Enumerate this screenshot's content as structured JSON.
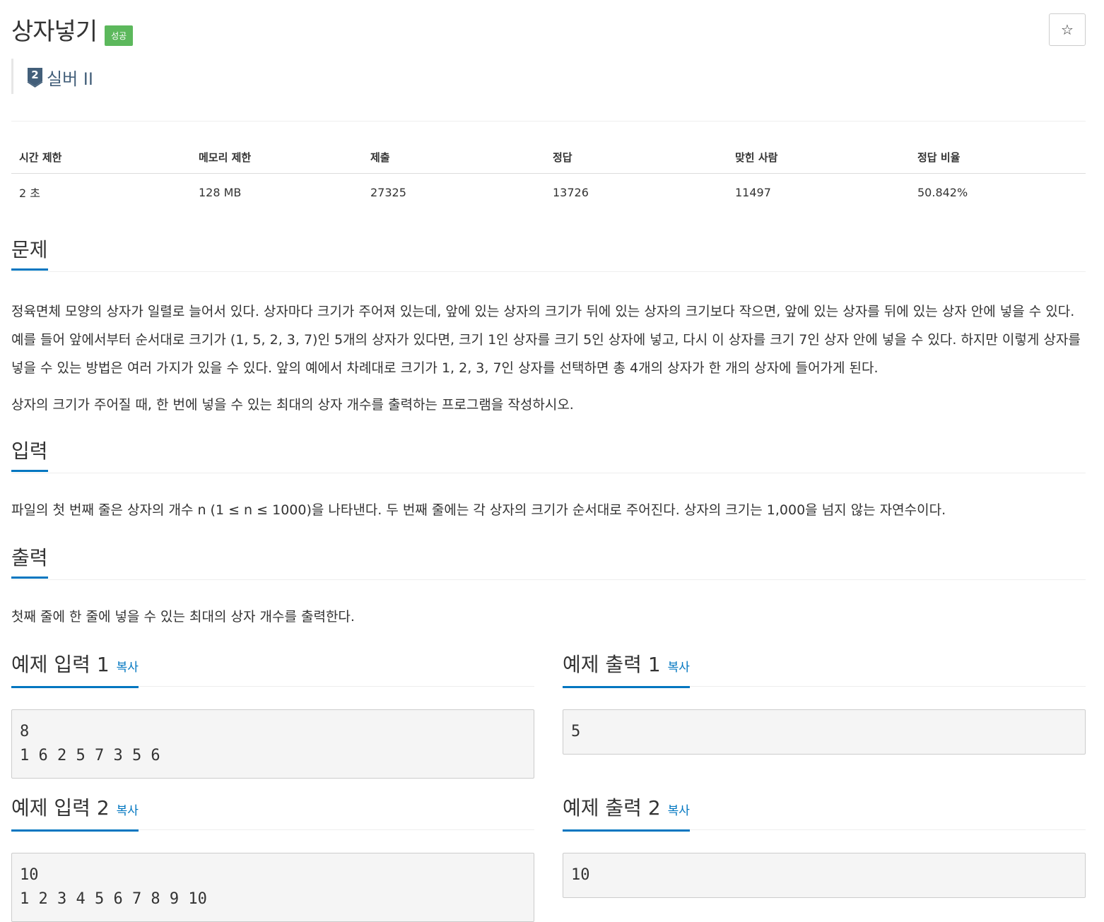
{
  "header": {
    "title": "상자넣기",
    "result_badge": "성공",
    "tier_label": "실버 II",
    "tier_number": "2",
    "star_icon_glyph": "☆"
  },
  "stats": {
    "headers": [
      "시간 제한",
      "메모리 제한",
      "제출",
      "정답",
      "맞힌 사람",
      "정답 비율"
    ],
    "values": [
      "2 초",
      "128 MB",
      "27325",
      "13726",
      "11497",
      "50.842%"
    ]
  },
  "problem": {
    "title": "문제",
    "paragraphs": [
      "정육면체 모양의 상자가 일렬로 늘어서 있다. 상자마다 크기가 주어져 있는데, 앞에 있는 상자의 크기가 뒤에 있는 상자의 크기보다 작으면, 앞에 있는 상자를 뒤에 있는 상자 안에 넣을 수 있다. 예를 들어 앞에서부터 순서대로 크기가 (1, 5, 2, 3, 7)인 5개의 상자가 있다면, 크기 1인 상자를 크기 5인 상자에 넣고, 다시 이 상자를 크기 7인 상자 안에 넣을 수 있다. 하지만 이렇게 상자를 넣을 수 있는 방법은 여러 가지가 있을 수 있다. 앞의 예에서 차례대로 크기가 1, 2, 3, 7인 상자를 선택하면 총 4개의 상자가 한 개의 상자에 들어가게 된다.",
      "상자의 크기가 주어질 때, 한 번에 넣을 수 있는 최대의 상자 개수를 출력하는 프로그램을 작성하시오."
    ]
  },
  "input": {
    "title": "입력",
    "text": "파일의 첫 번째 줄은 상자의 개수 n (1 ≤ n ≤ 1000)을 나타낸다. 두 번째 줄에는 각 상자의 크기가 순서대로 주어진다. 상자의 크기는 1,000을 넘지 않는 자연수이다."
  },
  "output": {
    "title": "출력",
    "text": "첫째 줄에 한 줄에 넣을 수 있는 최대의 상자 개수를 출력한다."
  },
  "samples": {
    "copy_label": "복사",
    "input1": {
      "title": "예제 입력 1",
      "content": "8\n1 6 2 5 7 3 5 6"
    },
    "output1": {
      "title": "예제 출력 1",
      "content": "5"
    },
    "input2": {
      "title": "예제 입력 2",
      "content": "10\n1 2 3 4 5 6 7 8 9 10"
    },
    "output2": {
      "title": "예제 출력 2",
      "content": "10"
    }
  },
  "colors": {
    "accent": "#0076c0",
    "success_badge": "#5cb85c",
    "tier_silver": "#435f7a"
  }
}
